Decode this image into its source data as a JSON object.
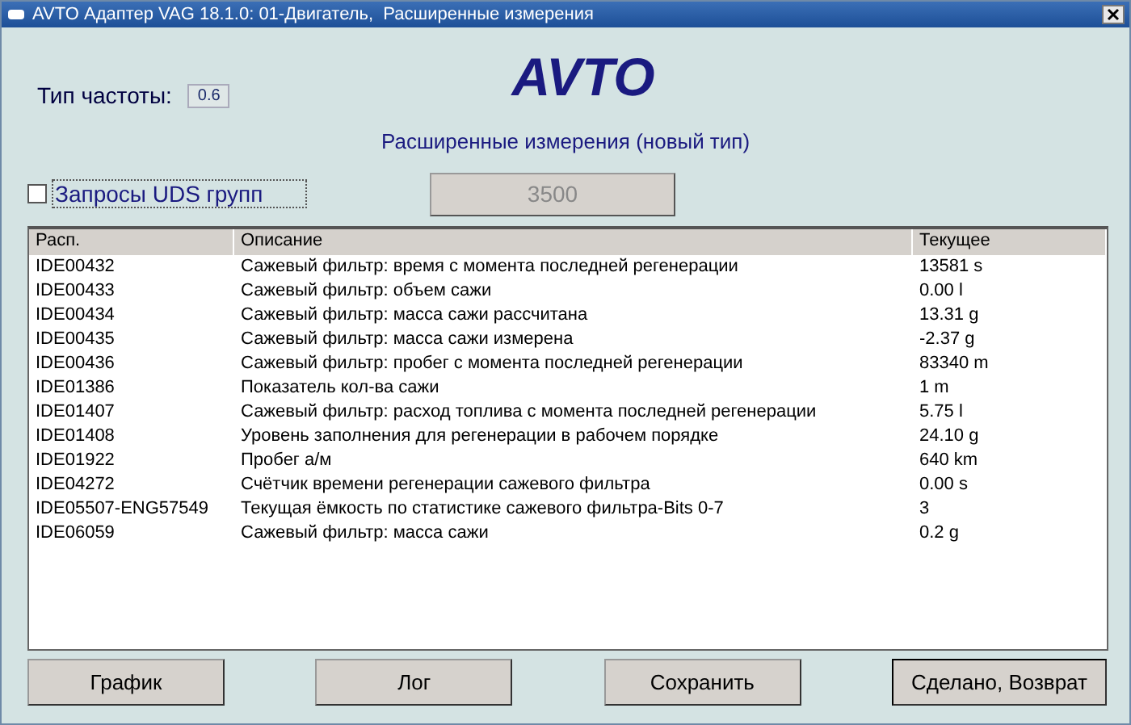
{
  "window": {
    "title": "AVTO Адаптер VAG 18.1.0: 01-Двигатель,  Расширенные измерения"
  },
  "frequency": {
    "label": "Тип частоты:",
    "value": "0.6"
  },
  "logo": "AVTO",
  "subtitle": "Расширенные измерения (новый тип)",
  "uds_checkbox": {
    "label": "Запросы UDS групп",
    "checked": false
  },
  "rpm_button": {
    "label": "3500",
    "disabled": true
  },
  "table": {
    "columns": [
      "Расп.",
      "Описание",
      "Текущее"
    ],
    "rows": [
      [
        "IDE00432",
        "Сажевый фильтр: время с момента последней регенерации",
        "13581 s"
      ],
      [
        "IDE00433",
        "Сажевый фильтр: объем сажи",
        "0.00 l"
      ],
      [
        "IDE00434",
        "Сажевый фильтр: масса сажи рассчитана",
        "13.31 g"
      ],
      [
        "IDE00435",
        "Сажевый фильтр: масса сажи измерена",
        "-2.37 g"
      ],
      [
        "IDE00436",
        "Сажевый фильтр: пробег с момента последней регенерации",
        "83340 m"
      ],
      [
        "IDE01386",
        "Показатель кол-ва сажи",
        "1 m"
      ],
      [
        "IDE01407",
        "Сажевый фильтр: расход топлива с момента последней регенерации",
        "5.75 l"
      ],
      [
        "IDE01408",
        "Уровень заполнения для регенерации в рабочем порядке",
        "24.10 g"
      ],
      [
        "IDE01922",
        "Пробег а/м",
        "640 km"
      ],
      [
        "IDE04272",
        "Счётчик времени регенерации сажевого фильтра",
        "0.00 s"
      ],
      [
        "IDE05507-ENG57549",
        "Текущая ёмкость по статистике сажевого фильтра-Bits 0-7",
        "3"
      ],
      [
        "IDE06059",
        "Сажевый фильтр: масса сажи",
        "0.2 g"
      ]
    ]
  },
  "buttons": [
    {
      "label": "График",
      "default": false
    },
    {
      "label": "Лог",
      "default": false
    },
    {
      "label": "Сохранить",
      "default": false
    },
    {
      "label": "Сделано, Возврат",
      "default": true
    }
  ]
}
